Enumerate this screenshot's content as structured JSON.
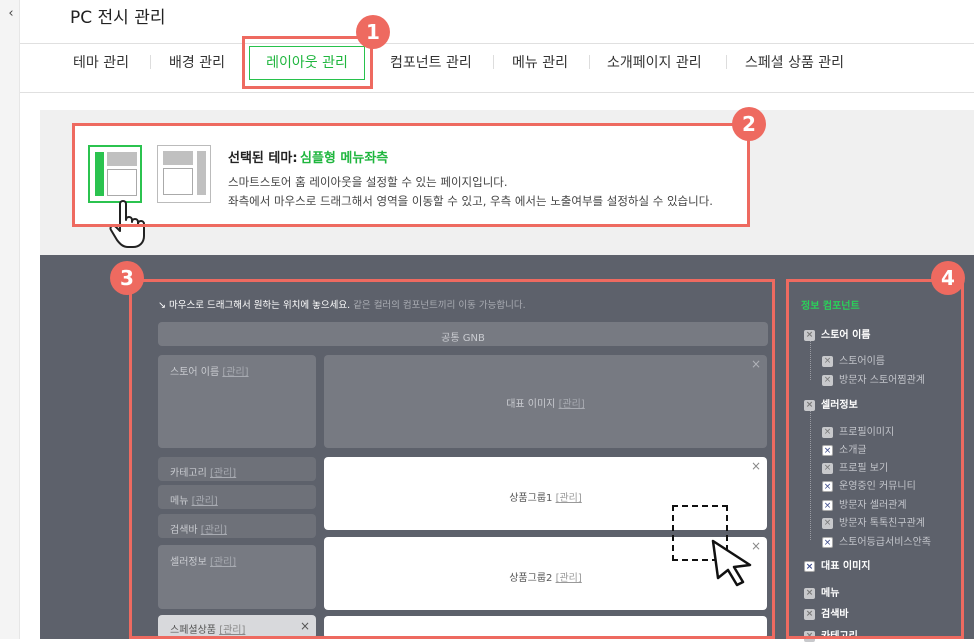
{
  "header": {
    "back_icon": "chevron-left-icon",
    "title": "PC 전시 관리"
  },
  "tabs": [
    {
      "label": "테마 관리"
    },
    {
      "label": "배경 관리"
    },
    {
      "label": "레이아웃 관리",
      "active": true
    },
    {
      "label": "컴포넌트 관리"
    },
    {
      "label": "메뉴 관리"
    },
    {
      "label": "소개페이지 관리"
    },
    {
      "label": "스페셜 상품 관리"
    }
  ],
  "badges": [
    "1",
    "2",
    "3",
    "4"
  ],
  "theme": {
    "selected_label": "선택된 테마:",
    "selected_name": "심플형 메뉴좌측",
    "desc1": "스마트스토어 홈 레이아웃을 설정할 수 있는 페이지입니다.",
    "desc2": "좌측에서 마우스로 드래그해서 영역을 이동할 수 있고, 우측 에서는 노출여부를 설정하실 수 있습니다."
  },
  "layout": {
    "hint_bold": "마우스로 드래그해서 원하는 위치에 놓으세요.",
    "hint_rest": " 같은 컬러의 컴포넌트끼리 이동 가능합니다.",
    "gnb": "공통 GNB",
    "manage": "[관리]",
    "store_name": "스토어 이름",
    "main_image": "대표 이미지",
    "category": "카테고리",
    "menu": "메뉴",
    "search": "검색바",
    "product_group1": "상품그룹1",
    "product_group2": "상품그룹2",
    "seller_info": "셀러정보",
    "special": "스페셜상품",
    "close": "×"
  },
  "components": {
    "title": "정보 컴포넌트",
    "items": [
      {
        "label": "스토어 이름",
        "level": 0,
        "checked": false
      },
      {
        "label": "스토어이름",
        "level": 1,
        "checked": false
      },
      {
        "label": "방문자 스토어찜관계",
        "level": 1,
        "checked": false
      },
      {
        "label": "셀러정보",
        "level": 0,
        "checked": false
      },
      {
        "label": "프로필이미지",
        "level": 1,
        "checked": false
      },
      {
        "label": "소개글",
        "level": 1,
        "checked": true
      },
      {
        "label": "프로필 보기",
        "level": 1,
        "checked": false
      },
      {
        "label": "운영중인 커뮤니티",
        "level": 1,
        "checked": true
      },
      {
        "label": "방문자 셀러관계",
        "level": 1,
        "checked": true
      },
      {
        "label": "방문자 톡톡친구관계",
        "level": 1,
        "checked": false
      },
      {
        "label": "스토어등급서비스안족",
        "level": 1,
        "checked": true
      },
      {
        "label": "대표 이미지",
        "level": 0,
        "checked": true
      },
      {
        "label": "메뉴",
        "level": 0,
        "checked": false
      },
      {
        "label": "검색바",
        "level": 0,
        "checked": false
      },
      {
        "label": "카테고리",
        "level": 0,
        "checked": false
      }
    ]
  },
  "colors": {
    "accent": "#1fb63e",
    "highlight": "#ee6a60",
    "dark_bg": "#5d616b"
  }
}
